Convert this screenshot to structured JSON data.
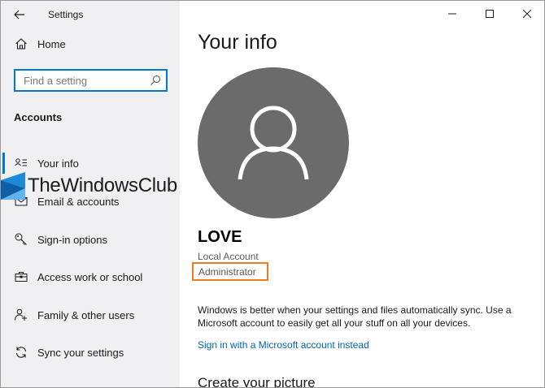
{
  "window": {
    "app_title": "Settings",
    "controls": [
      "minimize-icon",
      "maximize-icon",
      "close-icon"
    ]
  },
  "sidebar": {
    "home_label": "Home",
    "search": {
      "placeholder": "Find a setting",
      "value": ""
    },
    "section_title": "Accounts",
    "items": [
      {
        "label": "Your info",
        "icon": "person-card-icon",
        "selected": true
      },
      {
        "label": "Email & accounts",
        "icon": "envelope-icon",
        "selected": false
      },
      {
        "label": "Sign-in options",
        "icon": "key-icon",
        "selected": false
      },
      {
        "label": "Access work or school",
        "icon": "briefcase-icon",
        "selected": false
      },
      {
        "label": "Family & other users",
        "icon": "people-icon",
        "selected": false
      },
      {
        "label": "Sync your settings",
        "icon": "sync-icon",
        "selected": false
      }
    ],
    "watermark": "TheWindowsClub"
  },
  "main": {
    "title": "Your info",
    "user_name": "LOVE",
    "account_type": "Local Account",
    "role": "Administrator",
    "sync_message": "Windows is better when your settings and files automatically sync. Use a Microsoft account to easily get all your stuff on all your devices.",
    "ms_link": "Sign in with a Microsoft account instead",
    "picture_heading": "Create your picture"
  },
  "colors": {
    "accent": "#0078d7",
    "highlight_box": "#f07c1e",
    "link": "#0066b4",
    "avatar_bg": "#6b6b6b",
    "sidebar_bg": "#f0f0f3"
  }
}
